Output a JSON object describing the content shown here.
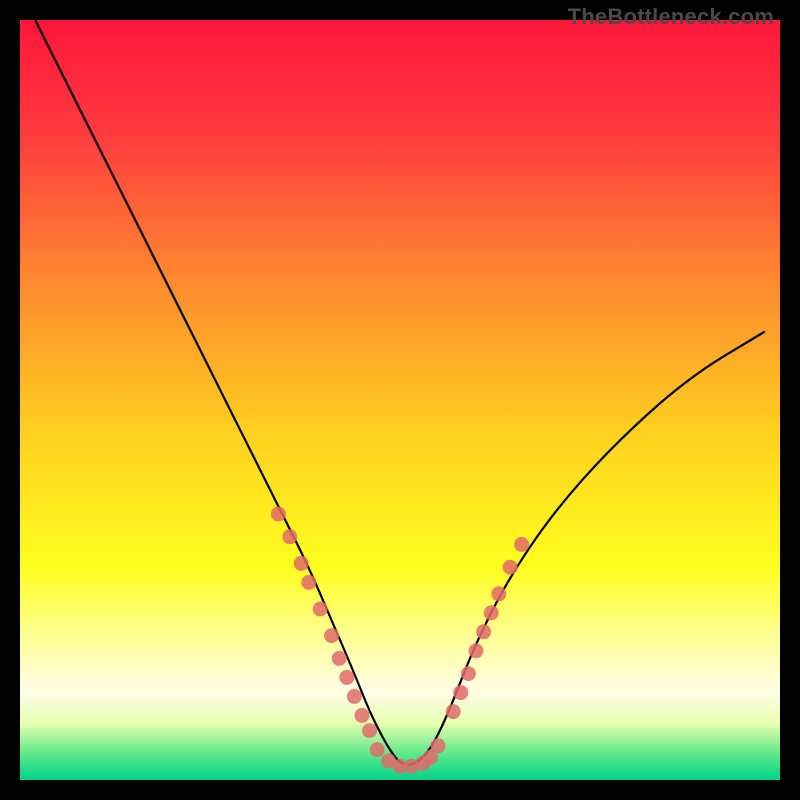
{
  "watermark": "TheBottleneck.com",
  "chart_data": {
    "type": "line",
    "title": "",
    "xlabel": "",
    "ylabel": "",
    "xlim": [
      0,
      100
    ],
    "ylim": [
      0,
      100
    ],
    "background_gradient": {
      "stops": [
        {
          "offset": 0.0,
          "color": "#ff163b"
        },
        {
          "offset": 0.15,
          "color": "#ff3b3e"
        },
        {
          "offset": 0.35,
          "color": "#ff8c2f"
        },
        {
          "offset": 0.55,
          "color": "#ffd21f"
        },
        {
          "offset": 0.72,
          "color": "#ffff1f"
        },
        {
          "offset": 0.82,
          "color": "#ffffa0"
        },
        {
          "offset": 0.885,
          "color": "#ffffe6"
        },
        {
          "offset": 0.925,
          "color": "#e6ffb0"
        },
        {
          "offset": 0.965,
          "color": "#5fe88a"
        },
        {
          "offset": 1.0,
          "color": "#00d488"
        }
      ]
    },
    "series": [
      {
        "name": "bottleneck-curve",
        "color": "#000000",
        "x": [
          2,
          6,
          10,
          14,
          18,
          22,
          26,
          30,
          34,
          38,
          41,
          44,
          46,
          48,
          50,
          52,
          54,
          56,
          58,
          60,
          64,
          70,
          78,
          88,
          98
        ],
        "y": [
          100,
          92,
          84,
          76,
          68,
          60,
          52,
          44,
          36,
          28,
          21,
          14,
          9,
          5,
          2,
          2,
          4,
          8,
          13,
          18,
          26,
          35,
          44,
          53,
          59
        ]
      }
    ],
    "scatter": [
      {
        "name": "markers-left",
        "color": "#e06a6a",
        "points": [
          {
            "x": 34.0,
            "y": 35.0
          },
          {
            "x": 35.5,
            "y": 32.0
          },
          {
            "x": 37.0,
            "y": 28.5
          },
          {
            "x": 38.0,
            "y": 26.0
          },
          {
            "x": 39.5,
            "y": 22.5
          },
          {
            "x": 41.0,
            "y": 19.0
          },
          {
            "x": 42.0,
            "y": 16.0
          },
          {
            "x": 43.0,
            "y": 13.5
          },
          {
            "x": 44.0,
            "y": 11.0
          },
          {
            "x": 45.0,
            "y": 8.5
          },
          {
            "x": 46.0,
            "y": 6.5
          }
        ]
      },
      {
        "name": "markers-bottom",
        "color": "#e06a6a",
        "points": [
          {
            "x": 47.0,
            "y": 4.0
          },
          {
            "x": 48.5,
            "y": 2.5
          },
          {
            "x": 50.0,
            "y": 1.8
          },
          {
            "x": 51.5,
            "y": 1.8
          },
          {
            "x": 53.0,
            "y": 2.2
          },
          {
            "x": 54.0,
            "y": 3.0
          },
          {
            "x": 55.0,
            "y": 4.5
          }
        ]
      },
      {
        "name": "markers-right",
        "color": "#e06a6a",
        "points": [
          {
            "x": 57.0,
            "y": 9.0
          },
          {
            "x": 58.0,
            "y": 11.5
          },
          {
            "x": 59.0,
            "y": 14.0
          },
          {
            "x": 60.0,
            "y": 17.0
          },
          {
            "x": 61.0,
            "y": 19.5
          },
          {
            "x": 62.0,
            "y": 22.0
          },
          {
            "x": 63.0,
            "y": 24.5
          },
          {
            "x": 64.5,
            "y": 28.0
          },
          {
            "x": 66.0,
            "y": 31.0
          }
        ]
      }
    ]
  }
}
